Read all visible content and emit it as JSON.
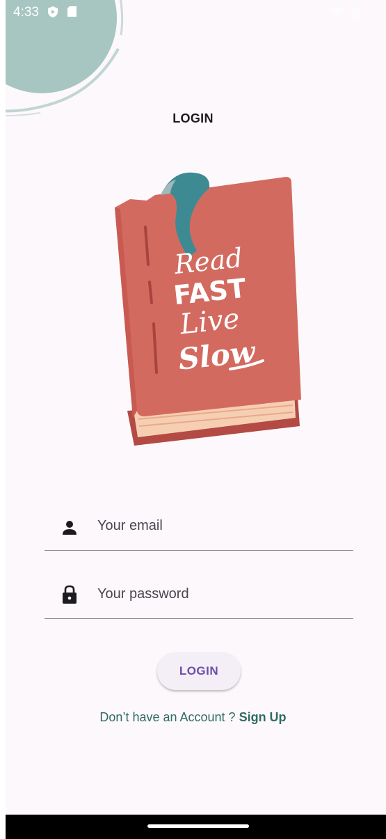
{
  "status_bar": {
    "time": "4:33",
    "icons": [
      "shield-play-icon",
      "sd-card-icon",
      "wifi-icon",
      "battery-icon"
    ]
  },
  "header": {
    "title": "LOGIN"
  },
  "illustration": {
    "lettering": "Read Fast Live Slow",
    "colors": {
      "cover": "#d36a60",
      "spine_shadow": "#b34a44",
      "pages": "#f6cfb3",
      "bookmark": "#3e8a93",
      "blob": "#a8c6c1"
    }
  },
  "form": {
    "email": {
      "placeholder": "Your email",
      "value": "",
      "icon": "person-icon"
    },
    "password": {
      "placeholder": "Your password",
      "value": "",
      "icon": "lock-icon"
    },
    "login_label": "LOGIN"
  },
  "signup": {
    "prompt": "Don’t have an Account ? ",
    "link_label": "Sign Up"
  }
}
